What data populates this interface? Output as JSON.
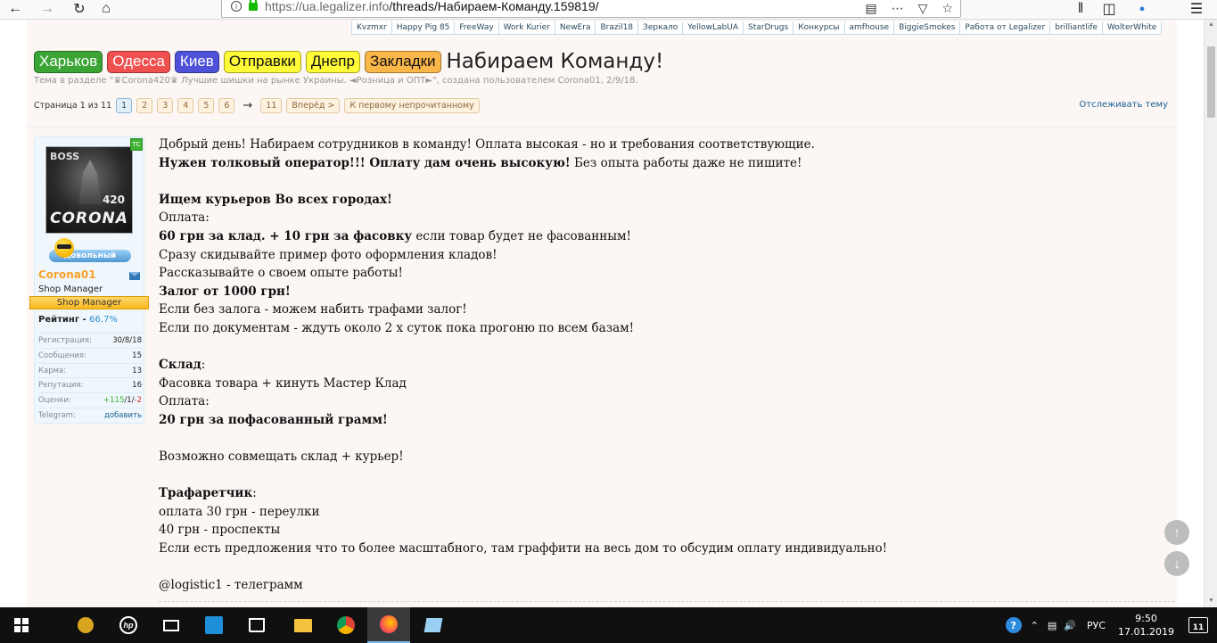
{
  "browser": {
    "url_host": "https://ua.legalizer.info",
    "url_path": "/threads/Набираем-Команду.159819/",
    "icons": [
      "back-icon",
      "forward-icon",
      "reload-icon",
      "home-icon",
      "reader-icon",
      "more-icon",
      "pocket-icon",
      "star-icon",
      "library-icon",
      "sidebar-icon",
      "extension-icon",
      "menu-icon"
    ]
  },
  "top_tabs": [
    "Kvzmxr",
    "Happy Pig 85",
    "FreeWay",
    "Work Kurier",
    "NewEra",
    "Brazil18",
    "Зеркало",
    "YellowLabUA",
    "StarDrugs",
    "Конкурсы",
    "amfhouse",
    "BiggieSmokes",
    "Работа от Legalizer",
    "brilliantlife",
    "WolterWhite"
  ],
  "cities": [
    {
      "label": "Харьков",
      "bg": "#3aa434",
      "color": "#ffffff"
    },
    {
      "label": "Одесса",
      "bg": "#f0504f",
      "color": "#ffffff"
    },
    {
      "label": "Киев",
      "bg": "#4f52d9",
      "color": "#ffffff"
    },
    {
      "label": "Отправки",
      "bg": "#fffb38",
      "color": "#111111"
    },
    {
      "label": "Днепр",
      "bg": "#fffb38",
      "color": "#111111"
    },
    {
      "label": "Закладки",
      "bg": "#f9b649",
      "color": "#111111"
    }
  ],
  "thread": {
    "title": "Набираем Команду!",
    "description": "Тема в разделе \"♛Corona420♛ Лучшие шишки на рынке Украины. ◄Розница и ОПТ►\", создана пользователем Corona01, 2/9/18."
  },
  "pagination": {
    "label": "Страница 1 из 11",
    "pages": [
      "1",
      "2",
      "3",
      "4",
      "5",
      "6"
    ],
    "arrow": "→",
    "last": "11",
    "next": "Вперёд >",
    "first_unread": "К первому непрочитанному",
    "watch": "Отслеживать тему"
  },
  "user": {
    "badge": "ТС",
    "avatar_text_top": "BOSS",
    "avatar_text_num": "420",
    "avatar_text_name": "CORONA",
    "mood": "довольный",
    "name": "Corona01",
    "title": "Shop Manager",
    "banner": "Shop Manager",
    "rating_label": "Рейтинг - ",
    "rating_value": "66.7%",
    "stats": [
      {
        "k": "Регистрация:",
        "v": "30/8/18"
      },
      {
        "k": "Сообщения:",
        "v": "15"
      },
      {
        "k": "Карма:",
        "v": "13"
      },
      {
        "k": "Репутация:",
        "v": "16"
      }
    ],
    "ratings_label": "Оценки:",
    "ratings_pos": "+115",
    "ratings_neu": "/1/",
    "ratings_neg": "-2",
    "telegram_label": "Telegram:",
    "telegram_value": "добавить"
  },
  "message": [
    {
      "t": "Добрый день! Набираем сотрудников в команду! Оплата высокая - но и требования соответствующие."
    },
    {
      "b": "Нужен толковый оператор!!! Оплату дам очень высокую!",
      "t": " Без опыта работы даже не пишите!"
    },
    {
      "t": ""
    },
    {
      "b": "Ищем курьеров Во всех городах!"
    },
    {
      "t": "Оплата:"
    },
    {
      "b": "60 грн за клад. + 10 грн за фасовку",
      "t": " если товар будет не фасованным!"
    },
    {
      "t": "Сразу скидывайте пример фото оформления кладов!"
    },
    {
      "t": "Рассказывайте о своем опыте работы!"
    },
    {
      "b": "Залог от 1000 грн!"
    },
    {
      "t": "Если без залога - можем набить трафами залог!"
    },
    {
      "t": "Если по документам - ждуть около 2 х суток пока прогоню по всем базам!"
    },
    {
      "t": ""
    },
    {
      "b": "Склад",
      "t": ":"
    },
    {
      "t": "Фасовка товара + кинуть Мастер Клад"
    },
    {
      "t": "Оплата:"
    },
    {
      "b": "20 грн за пофасованный грамм!"
    },
    {
      "t": ""
    },
    {
      "t": "Возможно совмещать склад + курьер!"
    },
    {
      "t": ""
    },
    {
      "b": "Трафаретчик",
      "t": ":"
    },
    {
      "t": "оплата 30 грн - переулки"
    },
    {
      "t": "40 грн - проспекты"
    },
    {
      "t": "Если есть предложения что то более масштабного, там граффити на весь дом то обсудим оплату индивидуально!"
    },
    {
      "t": ""
    },
    {
      "t": "@logistic1 - телеграмм"
    }
  ],
  "taskbar": {
    "lang": "РУС",
    "time": "9:50",
    "date": "17.01.2019",
    "notifications": "11",
    "apps": [
      "windows-start-icon",
      "mascot-icon",
      "hp-icon",
      "mail-icon",
      "rocket-icon",
      "store-icon",
      "folder-icon",
      "chrome-icon",
      "firefox-icon",
      "notepad-icon"
    ]
  }
}
